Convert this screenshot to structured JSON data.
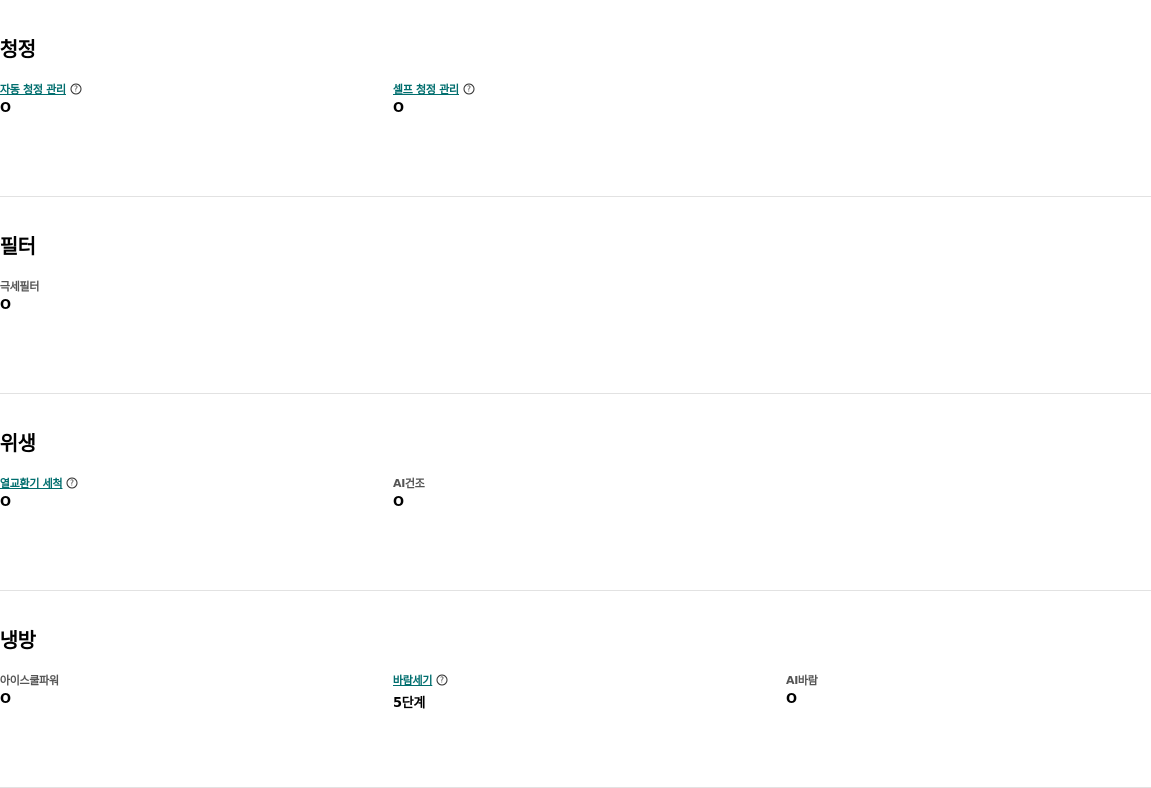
{
  "sections": [
    {
      "title": "청정",
      "specs": [
        {
          "label": "자동 청정 관리",
          "value": "O",
          "link": true,
          "help": true
        },
        {
          "label": "셀프 청정 관리",
          "value": "O",
          "link": true,
          "help": true
        }
      ]
    },
    {
      "title": "필터",
      "specs": [
        {
          "label": "극세필터",
          "value": "O",
          "link": false,
          "help": false
        }
      ]
    },
    {
      "title": "위생",
      "specs": [
        {
          "label": "열교환기 세척",
          "value": "O",
          "link": true,
          "help": true
        },
        {
          "label": "AI건조",
          "value": "O",
          "link": false,
          "help": false
        }
      ]
    },
    {
      "title": "냉방",
      "specs": [
        {
          "label": "아이스쿨파워",
          "value": "O",
          "link": false,
          "help": false
        },
        {
          "label": "바람세기",
          "value": "5단계",
          "link": true,
          "help": true
        },
        {
          "label": "AI바람",
          "value": "O",
          "link": false,
          "help": false
        }
      ]
    }
  ],
  "icons": {
    "help": "question-circle-icon"
  },
  "colors": {
    "link": "#006e6e",
    "label": "#555555",
    "divider": "#e2e2e2"
  }
}
